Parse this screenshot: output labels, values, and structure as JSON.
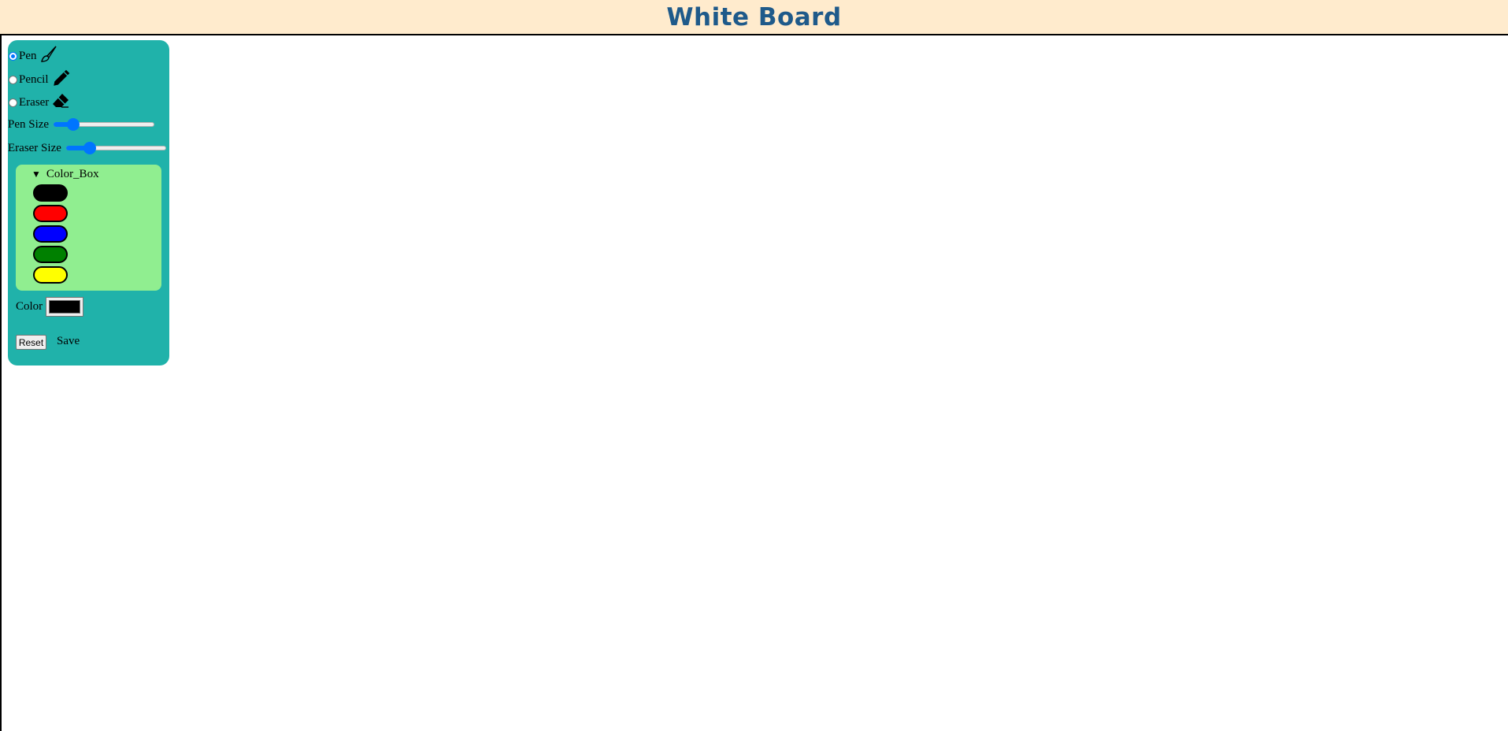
{
  "header": {
    "title": "White Board"
  },
  "toolbox": {
    "tools": [
      {
        "label": "Pen",
        "selected": true,
        "icon": "brush-icon"
      },
      {
        "label": "Pencil",
        "selected": false,
        "icon": "pencil-icon"
      },
      {
        "label": "Eraser",
        "selected": false,
        "icon": "eraser-icon"
      }
    ],
    "pen_size": {
      "label": "Pen Size",
      "value_fraction": 0.15,
      "accent": "#0075ff"
    },
    "eraser_size": {
      "label": "Eraser Size",
      "value_fraction": 0.2,
      "accent": "#0075ff"
    },
    "color_box": {
      "summary": "Color_Box",
      "expanded": true,
      "swatches": [
        "#000000",
        "#ff0000",
        "#0000ff",
        "#008000",
        "#ffff00"
      ]
    },
    "color": {
      "label": "Color",
      "value": "#000000"
    },
    "reset_label": "Reset",
    "save_label": "Save"
  },
  "colors": {
    "header_bg": "#ffebcd",
    "title": "#1f5a8a",
    "toolbox_bg": "#20b2aa",
    "color_box_bg": "#90ee90"
  }
}
